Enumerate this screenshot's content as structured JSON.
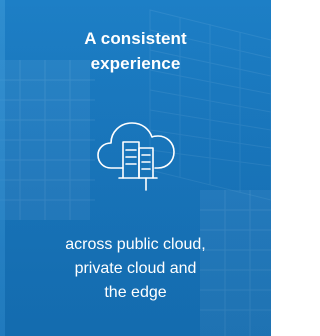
{
  "card": {
    "heading_line1": "A consistent",
    "heading_line2": "experience",
    "icon": "cloud-buildings-icon",
    "caption_line1": "across public cloud,",
    "caption_line2": "private cloud and",
    "caption_line3": "the edge"
  },
  "colors": {
    "background": "#1a78be",
    "text": "#ffffff"
  }
}
